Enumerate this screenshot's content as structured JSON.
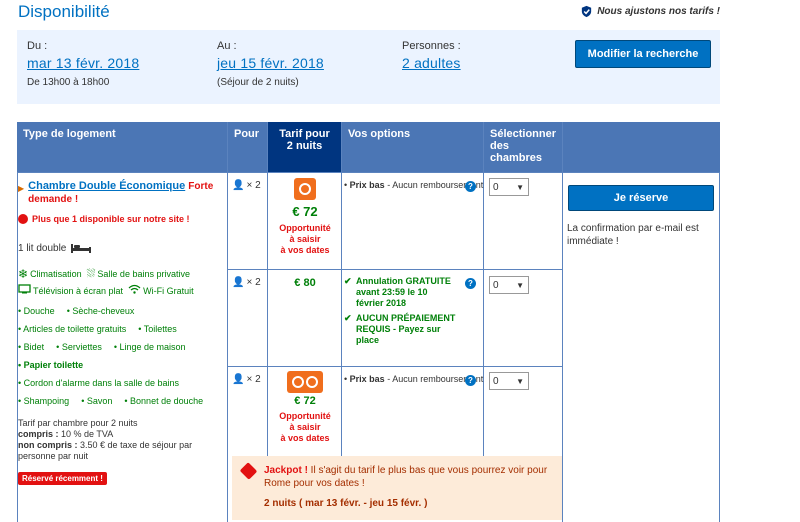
{
  "header": {
    "title": "Disponibilité",
    "tagline": "Nous ajustons nos tarifs !"
  },
  "search": {
    "checkin_label": "Du :",
    "checkin_value": "mar 13 févr. 2018",
    "checkin_sub": "De 13h00 à 18h00",
    "checkout_label": "Au :",
    "checkout_value": "jeu 15 févr. 2018",
    "checkout_sub": "(Séjour de 2 nuits)",
    "persons_label": "Personnes :",
    "persons_value": "2 adultes",
    "modify_button": "Modifier la recherche"
  },
  "table_headers": {
    "type": "Type de logement",
    "pour": "Pour",
    "tarif_line1": "Tarif pour",
    "tarif_line2": "2 nuits",
    "options": "Vos options",
    "select_line1": "Sélectionner",
    "select_line2": "des",
    "select_line3": "chambres"
  },
  "room": {
    "name": "Chambre Double Économique",
    "demand_line1": "Forte",
    "demand_line2": "demande !",
    "availability": "Plus que 1 disponible sur notre site !",
    "bed": "1 lit double",
    "facilities": {
      "clim": "Climatisation",
      "bath": "Salle de bains privative",
      "tv": "Télévision à écran plat",
      "wifi": "Wi-Fi Gratuit"
    },
    "amenities": {
      "row1": [
        "Douche",
        "Sèche-cheveux"
      ],
      "row2": [
        "Articles de toilette gratuits",
        "Toilettes"
      ],
      "row3": [
        "Bidet",
        "Serviettes",
        "Linge de maison"
      ],
      "row4": [
        "Papier toilette"
      ],
      "row5": [
        "Cordon d'alarme dans la salle de bains"
      ],
      "row6": [
        "Shampoing",
        "Savon",
        "Bonnet de douche"
      ]
    },
    "price_note_line1": "Tarif par chambre pour 2 nuits",
    "included_label": "compris :",
    "included_value": "10 % de TVA",
    "not_included_label": "non compris :",
    "not_included_value": "3.50 € de taxe de séjour par",
    "not_included_value2": "personne par nuit",
    "recent_badge": "Réservé récemment !"
  },
  "offers": [
    {
      "capacity": "× 2",
      "price": "€ 72",
      "opportunity": [
        "Opportunité",
        "à saisir",
        "à vos dates"
      ],
      "option_title": "Prix bas",
      "option_text": "- Aucun remboursement",
      "selected": "0"
    },
    {
      "capacity": "× 2",
      "price": "€ 80",
      "option_title": "Annulation GRATUITE avant 23:59 le 10 février 2018",
      "option2": "AUCUN PRÉPAIEMENT REQUIS - Payez sur place",
      "selected": "0"
    },
    {
      "capacity": "× 2",
      "price": "€ 72",
      "opportunity": [
        "Opportunité",
        "à saisir",
        "à vos dates"
      ],
      "option_title": "Prix bas",
      "option_text": "- Aucun remboursement",
      "selected": "0"
    }
  ],
  "booking": {
    "button": "Je réserve",
    "confirm": "La confirmation par e-mail est immédiate !"
  },
  "jackpot": {
    "label": "Jackpot !",
    "text": " Il s'agit du tarif le plus bas que vous pourrez voir pour Rome pour vos dates !",
    "dates": "2 nuits ( mar 13 févr. - jeu 15 févr. )"
  }
}
